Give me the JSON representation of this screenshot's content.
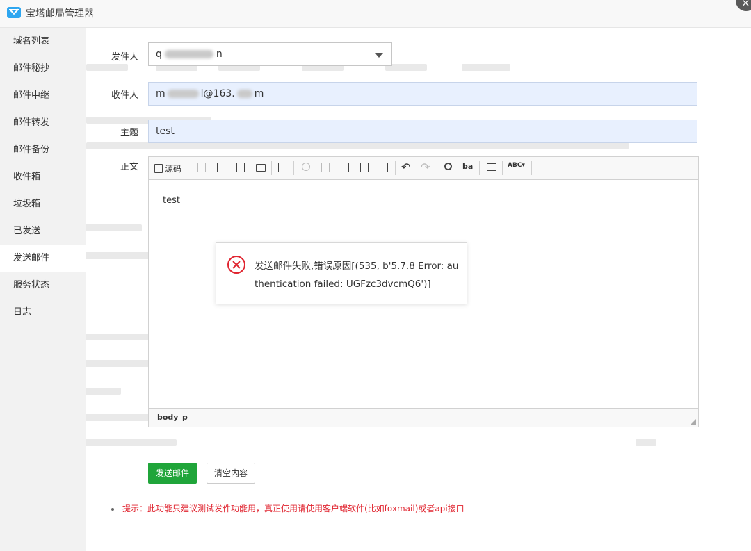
{
  "window": {
    "title": "宝塔邮局管理器",
    "close_label": "×"
  },
  "sidebar": {
    "items": [
      {
        "label": "域名列表"
      },
      {
        "label": "邮件秘抄"
      },
      {
        "label": "邮件中继"
      },
      {
        "label": "邮件转发"
      },
      {
        "label": "邮件备份"
      },
      {
        "label": "收件箱"
      },
      {
        "label": "垃圾箱"
      },
      {
        "label": "已发送"
      },
      {
        "label": "发送邮件",
        "active": true
      },
      {
        "label": "服务状态"
      },
      {
        "label": "日志"
      }
    ]
  },
  "form": {
    "sender_label": "发件人",
    "sender_value_start": "q",
    "sender_value_end": "n",
    "recipient_label": "收件人",
    "recipient_value_start": "m",
    "recipient_value_mid": "l@163.",
    "recipient_value_end": "m",
    "subject_label": "主题",
    "subject_value": "test",
    "body_label": "正文"
  },
  "editor": {
    "source_label": "源码",
    "content": "test",
    "path": [
      "body",
      "p"
    ],
    "tool_icons": [
      "save-icon",
      "new-page-icon",
      "preview-icon",
      "print-icon",
      "templates-icon",
      "cut-icon",
      "copy-icon",
      "paste-icon",
      "paste-text-icon",
      "paste-word-icon",
      "undo-icon",
      "redo-icon",
      "find-icon",
      "replace-icon",
      "select-all-icon",
      "spellcheck-icon"
    ]
  },
  "actions": {
    "send_label": "发送邮件",
    "clear_label": "清空内容"
  },
  "hint": "提示：此功能只建议测试发件功能用，真正使用请使用客户端软件(比如foxmail)或者api接口",
  "error_message": {
    "text": "发送邮件失败,错误原因[(535, b'5.7.8 Error: authentication failed: UGFzc3dvcmQ6')]"
  },
  "colors": {
    "primary": "#20a53a",
    "error": "#e0242f",
    "input_autofill": "#e8f0fe"
  }
}
